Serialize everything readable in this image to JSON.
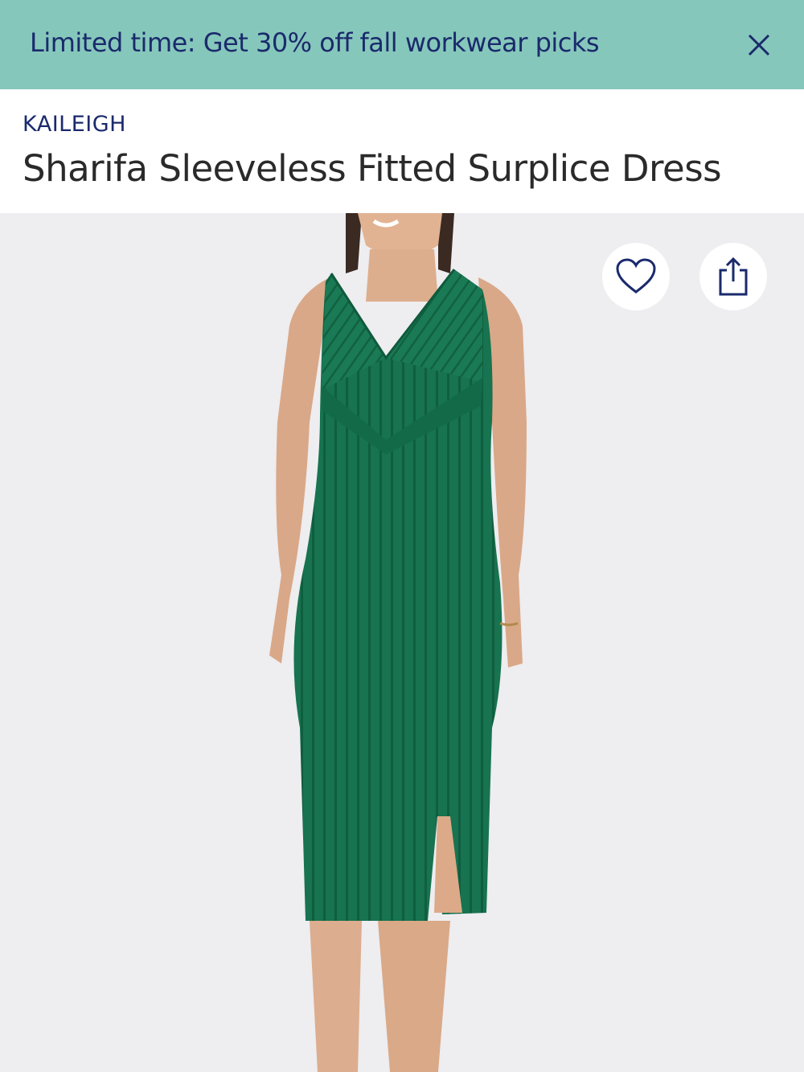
{
  "promo": {
    "text": "Limited time: Get 30% off fall workwear picks",
    "close_icon": "close-icon"
  },
  "product": {
    "brand": "KAILEIGH",
    "title": "Sharifa Sleeveless Fitted Surplice Dress"
  },
  "gallery": {
    "image_subject": "model wearing green ribbed midi dress",
    "favorite_icon": "heart-icon",
    "share_icon": "share-icon"
  },
  "colors": {
    "promo_bg": "#86c7bb",
    "brand_navy": "#1a2a6c",
    "dress_green": "#17704f",
    "photo_bg": "#eeedf0"
  }
}
